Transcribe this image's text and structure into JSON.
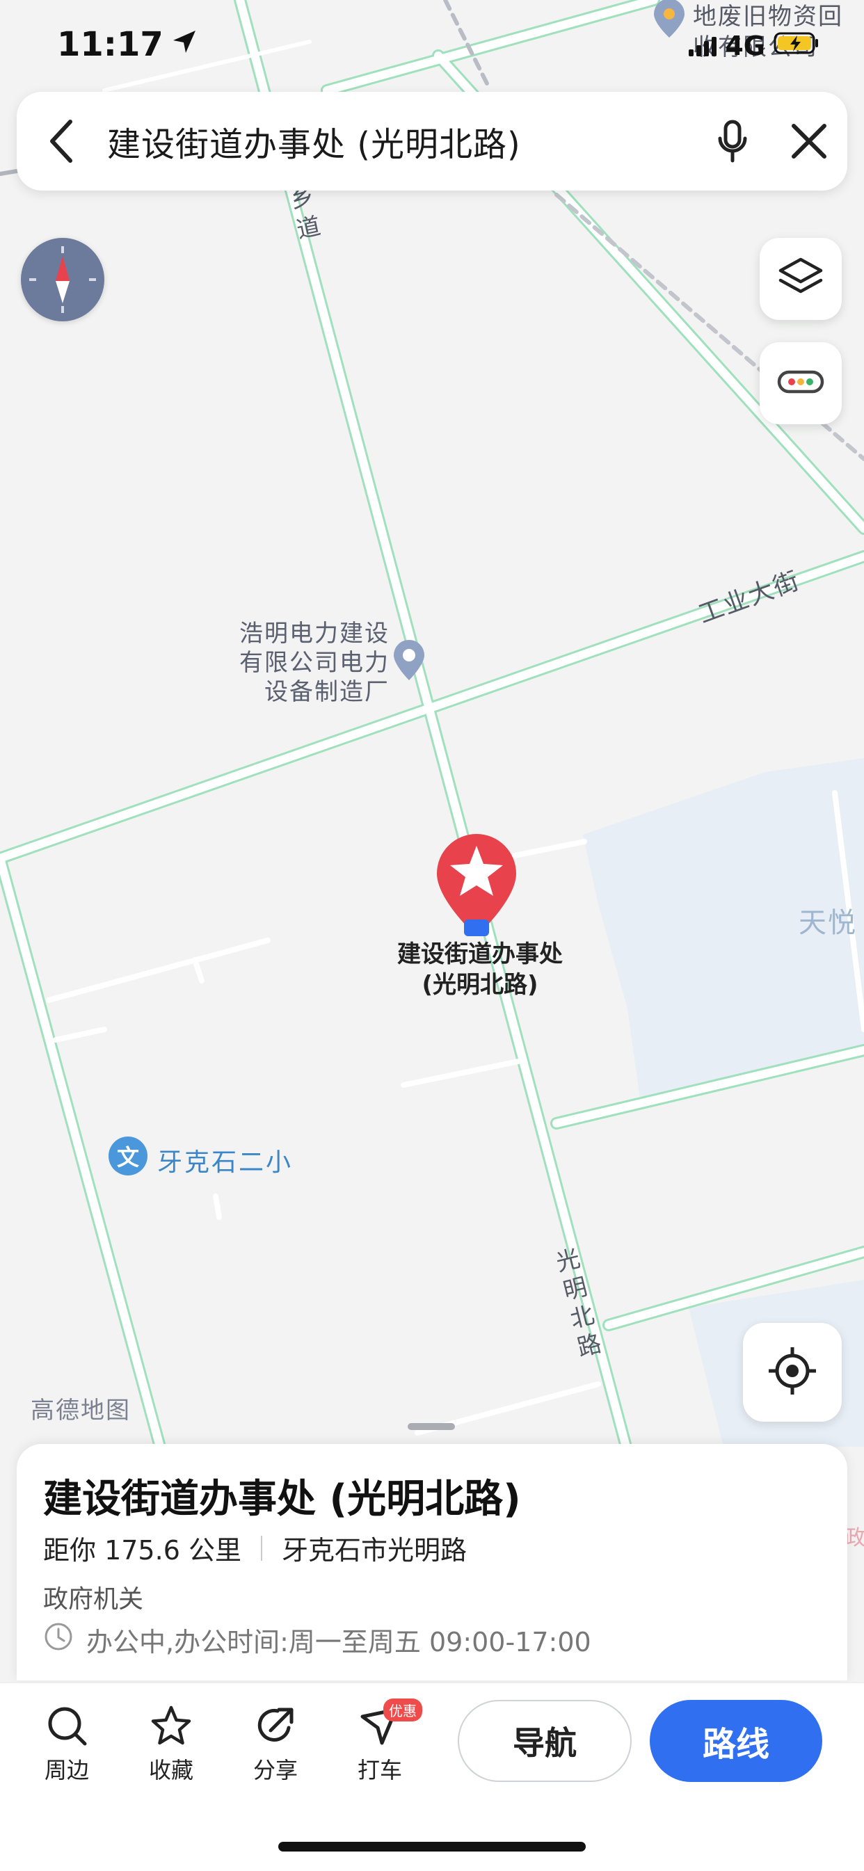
{
  "status_bar": {
    "time": "11:17",
    "network": "4G"
  },
  "search": {
    "query": "建设街道办事处 (光明北路)"
  },
  "map": {
    "labels": {
      "top_poi": "地废旧物资回收有限公司",
      "road_top_left": "乡道",
      "road_industry": "工业大街",
      "poi_left_line1": "浩明电力建设",
      "poi_left_line2": "有限公司电力",
      "poi_left_line3": "设备制造厂",
      "tianyue": "天悦",
      "school": "牙克石二小",
      "school_icon_char": "文",
      "road_guangming": "光明北路",
      "marker_line1": "建设街道办事处",
      "marker_line2": "(光明北路)",
      "logo": "高德地图",
      "edge_label": "政"
    },
    "colors": {
      "road_casing": "#9fe0bd",
      "road_fill": "#ffffff",
      "block": "#e8eef6",
      "marker": "#e8434d"
    }
  },
  "place": {
    "name": "建设街道办事处 (光明北路)",
    "distance": "距你 175.6 公里",
    "address": "牙克石市光明路",
    "category": "政府机关",
    "hours": "办公中,办公时间:周一至周五 09:00-17:00"
  },
  "toolbar": {
    "nearby": "周边",
    "favorite": "收藏",
    "share": "分享",
    "taxi": "打车",
    "taxi_badge": "优惠",
    "navigate": "导航",
    "route": "路线"
  },
  "icons": [
    "location-arrow-icon",
    "signal-icon",
    "battery-charging-icon",
    "back-icon",
    "mic-icon",
    "close-icon",
    "compass-icon",
    "layers-icon",
    "toolbox-icon",
    "locate-icon",
    "poi-pin-icon",
    "school-icon",
    "search-icon",
    "star-icon",
    "share-icon",
    "taxi-icon",
    "clock-icon"
  ]
}
